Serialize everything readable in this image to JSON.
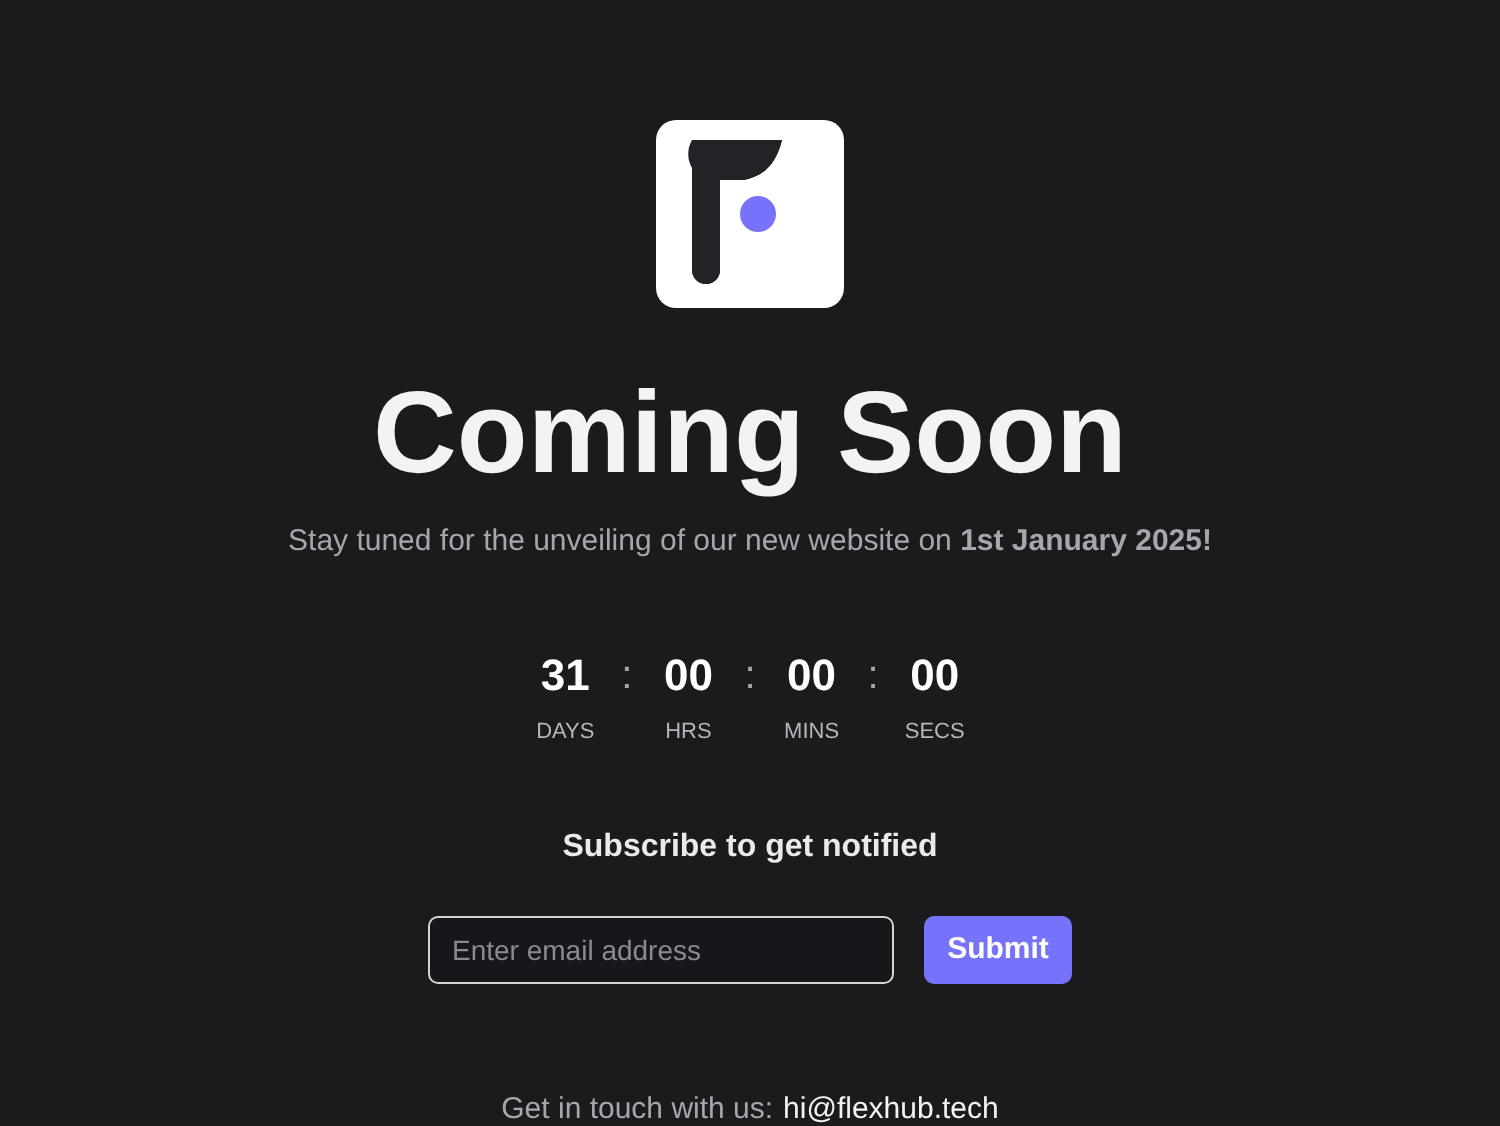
{
  "title": "Coming Soon",
  "subtitle": "Stay tuned for the unveiling of our new website on **1st January 2025!**",
  "countdown": [
    {
      "value": "31",
      "label": "DAYS"
    },
    {
      "value": "00",
      "label": "HRS"
    },
    {
      "value": "00",
      "label": "MINS"
    },
    {
      "value": "00",
      "label": "SECS"
    }
  ],
  "separator": ":",
  "subscribe": {
    "heading": "Subscribe to get notified",
    "placeholder": "Enter email address",
    "button": "Submit"
  },
  "footer": {
    "text": "Get in touch with us:",
    "email": "hi@flexhub.tech"
  }
}
